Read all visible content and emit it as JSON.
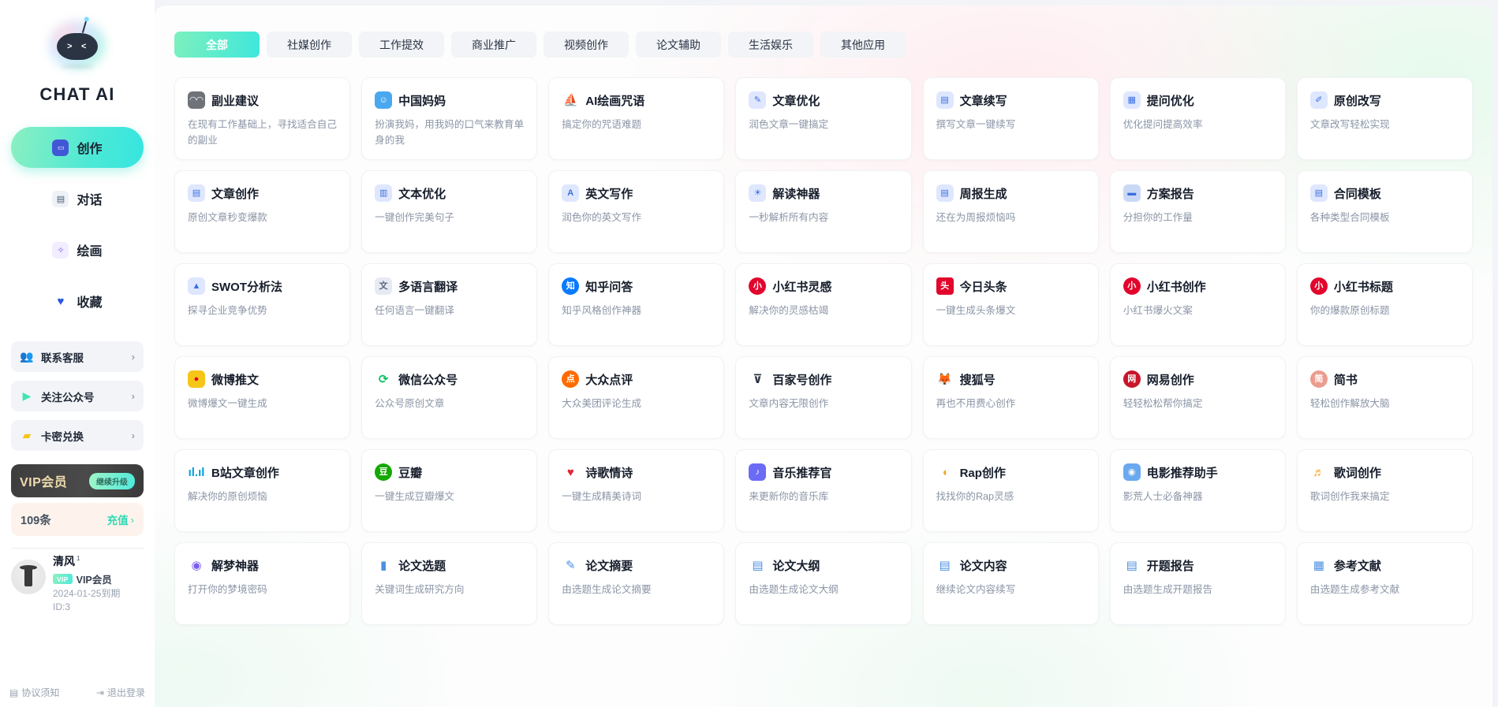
{
  "brand": {
    "name": "CHAT AI",
    "logo_icon": "robot-logo-icon"
  },
  "sidebar": {
    "nav": [
      {
        "label": "创作",
        "icon": "robot-icon",
        "active": true
      },
      {
        "label": "对话",
        "icon": "chat-bubble-icon",
        "active": false
      },
      {
        "label": "绘画",
        "icon": "paint-brush-icon",
        "active": false
      },
      {
        "label": "收藏",
        "icon": "heart-icon",
        "active": false
      }
    ],
    "links": [
      {
        "label": "联系客服",
        "icon": "customer-service-icon",
        "arrow": "›"
      },
      {
        "label": "关注公众号",
        "icon": "megaphone-icon",
        "arrow": "›"
      },
      {
        "label": "卡密兑换",
        "icon": "card-key-icon",
        "arrow": "›"
      }
    ],
    "vip": {
      "title": "VIP会员",
      "button": "继续升级"
    },
    "credit": {
      "count": "109条",
      "action": "充值",
      "arrow": "›"
    },
    "profile": {
      "name": "清风",
      "level": "1",
      "badge": "VIP",
      "vip_label": "VIP会员",
      "expiry": "2024-01-25到期",
      "id": "ID:3",
      "avatar_icon": "user-avatar"
    },
    "footer": {
      "agreement": "协议须知",
      "agreement_icon": "document-icon",
      "logout": "退出登录",
      "logout_icon": "logout-icon"
    }
  },
  "tabs": [
    {
      "label": "全部",
      "active": true
    },
    {
      "label": "社媒创作",
      "active": false
    },
    {
      "label": "工作提效",
      "active": false
    },
    {
      "label": "商业推广",
      "active": false
    },
    {
      "label": "视频创作",
      "active": false
    },
    {
      "label": "论文辅助",
      "active": false
    },
    {
      "label": "生活娱乐",
      "active": false
    },
    {
      "label": "其他应用",
      "active": false
    }
  ],
  "colors": {
    "accent_start": "#7df0bd",
    "accent_end": "#3fe7dc",
    "text_primary": "#161d2b",
    "text_secondary": "#8b95a6",
    "vip_card": "#3d3d3d",
    "vip_gold": "#f0dcae"
  },
  "cards": [
    {
      "title": "副业建议",
      "desc": "在现有工作基础上，寻找适合自己的副业",
      "icon": "ninja-face-icon",
      "bg": "#6f7278",
      "glyph": "◠◠"
    },
    {
      "title": "中国妈妈",
      "desc": "扮演我妈，用我妈的口气来教育单身的我",
      "icon": "person-blue-icon",
      "bg": "#4aa8f0",
      "glyph": "☺"
    },
    {
      "title": "AI绘画咒语",
      "desc": "搞定你的咒语难题",
      "icon": "sailboat-icon",
      "bg": "#ffffff",
      "fg": "#2b3442",
      "glyph": "⛵"
    },
    {
      "title": "文章优化",
      "desc": "润色文章一键搞定",
      "icon": "pencil-doc-icon",
      "bg": "#dfe7ff",
      "fg": "#3b6fe0",
      "glyph": "✎"
    },
    {
      "title": "文章续写",
      "desc": "撰写文章一键续写",
      "icon": "doc-check-icon",
      "bg": "#dfe7ff",
      "fg": "#3b6fe0",
      "glyph": "▤"
    },
    {
      "title": "提问优化",
      "desc": "优化提问提高效率",
      "icon": "doc-question-icon",
      "bg": "#dfe7ff",
      "fg": "#3b6fe0",
      "glyph": "▦"
    },
    {
      "title": "原创改写",
      "desc": "文章改写轻松实现",
      "icon": "rewrite-icon",
      "bg": "#dfe7ff",
      "fg": "#3b6fe0",
      "glyph": "✐"
    },
    {
      "title": "文章创作",
      "desc": "原创文章秒变爆款",
      "icon": "doc-pen-icon",
      "bg": "#dfe7ff",
      "fg": "#3b6fe0",
      "glyph": "▤"
    },
    {
      "title": "文本优化",
      "desc": "一键创作完美句子",
      "icon": "text-edit-icon",
      "bg": "#dfe7ff",
      "fg": "#3b6fe0",
      "glyph": "▥"
    },
    {
      "title": "英文写作",
      "desc": "润色你的英文写作",
      "icon": "letter-a-icon",
      "bg": "#dfe7ff",
      "fg": "#3b6fe0",
      "glyph": "A"
    },
    {
      "title": "解读神器",
      "desc": "一秒解析所有内容",
      "icon": "lightbulb-icon",
      "bg": "#dfe7ff",
      "fg": "#3b6fe0",
      "glyph": "☀"
    },
    {
      "title": "周报生成",
      "desc": "还在为周报烦恼吗",
      "icon": "report-icon",
      "bg": "#dfe7ff",
      "fg": "#3b6fe0",
      "glyph": "▤"
    },
    {
      "title": "方案报告",
      "desc": "分担你的工作量",
      "icon": "presentation-icon",
      "bg": "#c9d9f5",
      "fg": "#3b6fe0",
      "glyph": "▬"
    },
    {
      "title": "合同模板",
      "desc": "各种类型合同模板",
      "icon": "contract-icon",
      "bg": "#dfe7ff",
      "fg": "#3b6fe0",
      "glyph": "▤"
    },
    {
      "title": "SWOT分析法",
      "desc": "探寻企业竞争优势",
      "icon": "analysis-icon",
      "bg": "#dfe7ff",
      "fg": "#3b6fe0",
      "glyph": "▲"
    },
    {
      "title": "多语言翻译",
      "desc": "任何语言一键翻译",
      "icon": "translate-icon",
      "bg": "#e6eaf2",
      "fg": "#5b6880",
      "glyph": "文"
    },
    {
      "title": "知乎问答",
      "desc": "知乎风格创作神器",
      "icon": "zhihu-icon",
      "bg": "#0a7aff",
      "fg": "#ffffff",
      "glyph": "知"
    },
    {
      "title": "小红书灵感",
      "desc": "解决你的灵感枯竭",
      "icon": "xiaohongshu-icon",
      "bg": "#e2062c",
      "fg": "#ffffff",
      "glyph": "小"
    },
    {
      "title": "今日头条",
      "desc": "一键生成头条爆文",
      "icon": "toutiao-icon",
      "bg": "#e2062c",
      "fg": "#ffffff",
      "glyph": "头"
    },
    {
      "title": "小红书创作",
      "desc": "小红书爆火文案",
      "icon": "xiaohongshu-icon",
      "bg": "#e2062c",
      "fg": "#ffffff",
      "glyph": "小"
    },
    {
      "title": "小红书标题",
      "desc": "你的爆款原创标题",
      "icon": "xiaohongshu-icon",
      "bg": "#e2062c",
      "fg": "#ffffff",
      "glyph": "小"
    },
    {
      "title": "微博推文",
      "desc": "微博爆文一键生成",
      "icon": "weibo-icon",
      "bg": "#f5c518",
      "fg": "#e2062c",
      "glyph": "●"
    },
    {
      "title": "微信公众号",
      "desc": "公众号原创文章",
      "icon": "wechat-icon",
      "bg": "#ffffff",
      "fg": "#07c160",
      "glyph": "⟳"
    },
    {
      "title": "大众点评",
      "desc": "大众美团评论生成",
      "icon": "dianping-icon",
      "bg": "#ff6a00",
      "fg": "#ffffff",
      "glyph": "点"
    },
    {
      "title": "百家号创作",
      "desc": "文章内容无限创作",
      "icon": "baijiahao-icon",
      "bg": "#ffffff",
      "fg": "#2b3442",
      "glyph": "⊽"
    },
    {
      "title": "搜狐号",
      "desc": "再也不用费心创作",
      "icon": "sohu-icon",
      "bg": "#ffffff",
      "fg": "#f5c518",
      "glyph": "🦊"
    },
    {
      "title": "网易创作",
      "desc": "轻轻松松帮你搞定",
      "icon": "netease-icon",
      "bg": "#c8152a",
      "fg": "#ffffff",
      "glyph": "网"
    },
    {
      "title": "简书",
      "desc": "轻松创作解放大脑",
      "icon": "jianshu-icon",
      "bg": "#ea9c8e",
      "fg": "#ffffff",
      "glyph": "简"
    },
    {
      "title": "B站文章创作",
      "desc": "解决你的原创烦恼",
      "icon": "bilibili-icon",
      "bg": "#ffffff",
      "fg": "#00a1d6",
      "glyph": "ıl.ıl"
    },
    {
      "title": "豆瓣",
      "desc": "一键生成豆瓣爆文",
      "icon": "douban-icon",
      "bg": "#14a800",
      "fg": "#ffffff",
      "glyph": "豆"
    },
    {
      "title": "诗歌情诗",
      "desc": "一键生成精美诗词",
      "icon": "heart-red-icon",
      "bg": "#ffffff",
      "fg": "#e2253c",
      "glyph": "♥"
    },
    {
      "title": "音乐推荐官",
      "desc": "来更新你的音乐库",
      "icon": "music-note-icon",
      "bg": "#6b6bf5",
      "fg": "#ffffff",
      "glyph": "♪"
    },
    {
      "title": "Rap创作",
      "desc": "找找你的Rap灵感",
      "icon": "megaphone-orange-icon",
      "bg": "#ffffff",
      "fg": "#f5a623",
      "glyph": "◖"
    },
    {
      "title": "电影推荐助手",
      "desc": "影荒人士必备神器",
      "icon": "film-reel-icon",
      "bg": "#6aa9f0",
      "fg": "#ffffff",
      "glyph": "◉"
    },
    {
      "title": "歌词创作",
      "desc": "歌词创作我来搞定",
      "icon": "lyrics-icon",
      "bg": "#ffffff",
      "fg": "#f5a623",
      "glyph": "♬"
    },
    {
      "title": "解梦神器",
      "desc": "打开你的梦境密码",
      "icon": "dream-icon",
      "bg": "#ffffff",
      "fg": "#7b5cf0",
      "glyph": "◉"
    },
    {
      "title": "论文选题",
      "desc": "关键词生成研究方向",
      "icon": "paper-topic-icon",
      "bg": "#ffffff",
      "fg": "#4a90e2",
      "glyph": "▮"
    },
    {
      "title": "论文摘要",
      "desc": "由选题生成论文摘要",
      "icon": "paper-abstract-icon",
      "bg": "#ffffff",
      "fg": "#4a90e2",
      "glyph": "✎"
    },
    {
      "title": "论文大纲",
      "desc": "由选题生成论文大纲",
      "icon": "paper-outline-icon",
      "bg": "#ffffff",
      "fg": "#4a90e2",
      "glyph": "▤"
    },
    {
      "title": "论文内容",
      "desc": "继续论文内容续写",
      "icon": "paper-content-icon",
      "bg": "#ffffff",
      "fg": "#4a90e2",
      "glyph": "▤"
    },
    {
      "title": "开题报告",
      "desc": "由选题生成开题报告",
      "icon": "proposal-icon",
      "bg": "#ffffff",
      "fg": "#4a90e2",
      "glyph": "▤"
    },
    {
      "title": "参考文献",
      "desc": "由选题生成参考文献",
      "icon": "reference-icon",
      "bg": "#ffffff",
      "fg": "#4a90e2",
      "glyph": "▦"
    }
  ]
}
